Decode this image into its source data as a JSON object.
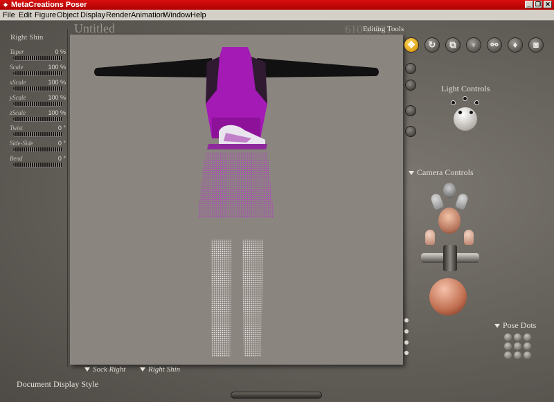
{
  "window": {
    "title": "MetaCreations Poser",
    "controls": [
      "_",
      "❐",
      "✕"
    ]
  },
  "menu": [
    "File",
    "Edit",
    "Figure",
    "Object",
    "Display",
    "Render",
    "Animation",
    "Window",
    "Help"
  ],
  "document": {
    "title": "Untitled",
    "size": "610 x 471"
  },
  "parameters": {
    "title": "Right Shin",
    "dials": [
      {
        "label": "Taper",
        "value": "0 %"
      },
      {
        "label": "Scale",
        "value": "100 %"
      },
      {
        "label": "xScale",
        "value": "100 %"
      },
      {
        "label": "yScale",
        "value": "100 %"
      },
      {
        "label": "zScale",
        "value": "100 %"
      },
      {
        "label": "Twist",
        "value": "0 °"
      },
      {
        "label": "Side-Side",
        "value": "0 °"
      },
      {
        "label": "Bend",
        "value": "0 °"
      }
    ]
  },
  "editing_tools": {
    "label": "Editing Tools",
    "selected": "translate-tool"
  },
  "light_controls": {
    "label": "Light Controls"
  },
  "camera_controls": {
    "label": "Camera Controls"
  },
  "pose_dots": {
    "label": "Pose Dots"
  },
  "figure_bar": {
    "figure": "Sock Right",
    "part": "Right Shin"
  },
  "display_style": {
    "label": "Document Display Style"
  },
  "colors": {
    "shirt": "#a31ab5",
    "sleeves": "#111111",
    "viewport_bg": "#8b857f",
    "accent": "#e3a100"
  }
}
